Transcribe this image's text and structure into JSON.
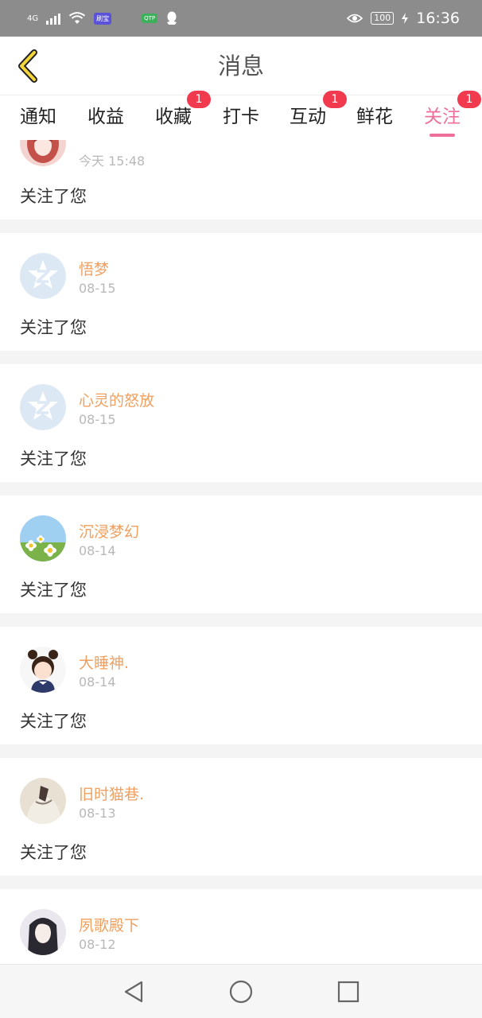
{
  "status_bar": {
    "network_label": "4G",
    "app_badge_1": "刷宝",
    "app_badge_2": "QTP",
    "battery": "100",
    "time": "16:36"
  },
  "header": {
    "title": "消息",
    "back_icon": "chevron-left-icon"
  },
  "tabs": [
    {
      "label": "通知",
      "badge": ""
    },
    {
      "label": "收益",
      "badge": ""
    },
    {
      "label": "收藏",
      "badge": "1"
    },
    {
      "label": "打卡",
      "badge": ""
    },
    {
      "label": "互动",
      "badge": "1"
    },
    {
      "label": "鲜花",
      "badge": ""
    },
    {
      "label": "关注",
      "badge": "1",
      "active": true
    }
  ],
  "colors": {
    "accent": "#ef6f9b",
    "username": "#f0a060",
    "badge": "#f23a4f"
  },
  "messages": [
    {
      "username": "",
      "time": "今天 15:48",
      "text": "关注了您",
      "avatar": "anime-girl-avatar"
    },
    {
      "username": "悟梦",
      "time": "08-15",
      "text": "关注了您",
      "avatar": "default-z-avatar"
    },
    {
      "username": "心灵的怒放",
      "time": "08-15",
      "text": "关注了您",
      "avatar": "default-z-avatar"
    },
    {
      "username": "沉浸梦幻",
      "time": "08-14",
      "text": "关注了您",
      "avatar": "daisy-avatar"
    },
    {
      "username": "大睡神.",
      "time": "08-14",
      "text": "关注了您",
      "avatar": "child-avatar"
    },
    {
      "username": "旧时猫巷.",
      "time": "08-13",
      "text": "关注了您",
      "avatar": "cat-avatar"
    },
    {
      "username": "夙歌殿下",
      "time": "08-12",
      "text": "",
      "avatar": "anime-boy-avatar"
    }
  ],
  "nav": {
    "back": "triangle-back-icon",
    "home": "circle-home-icon",
    "recents": "square-recents-icon"
  }
}
